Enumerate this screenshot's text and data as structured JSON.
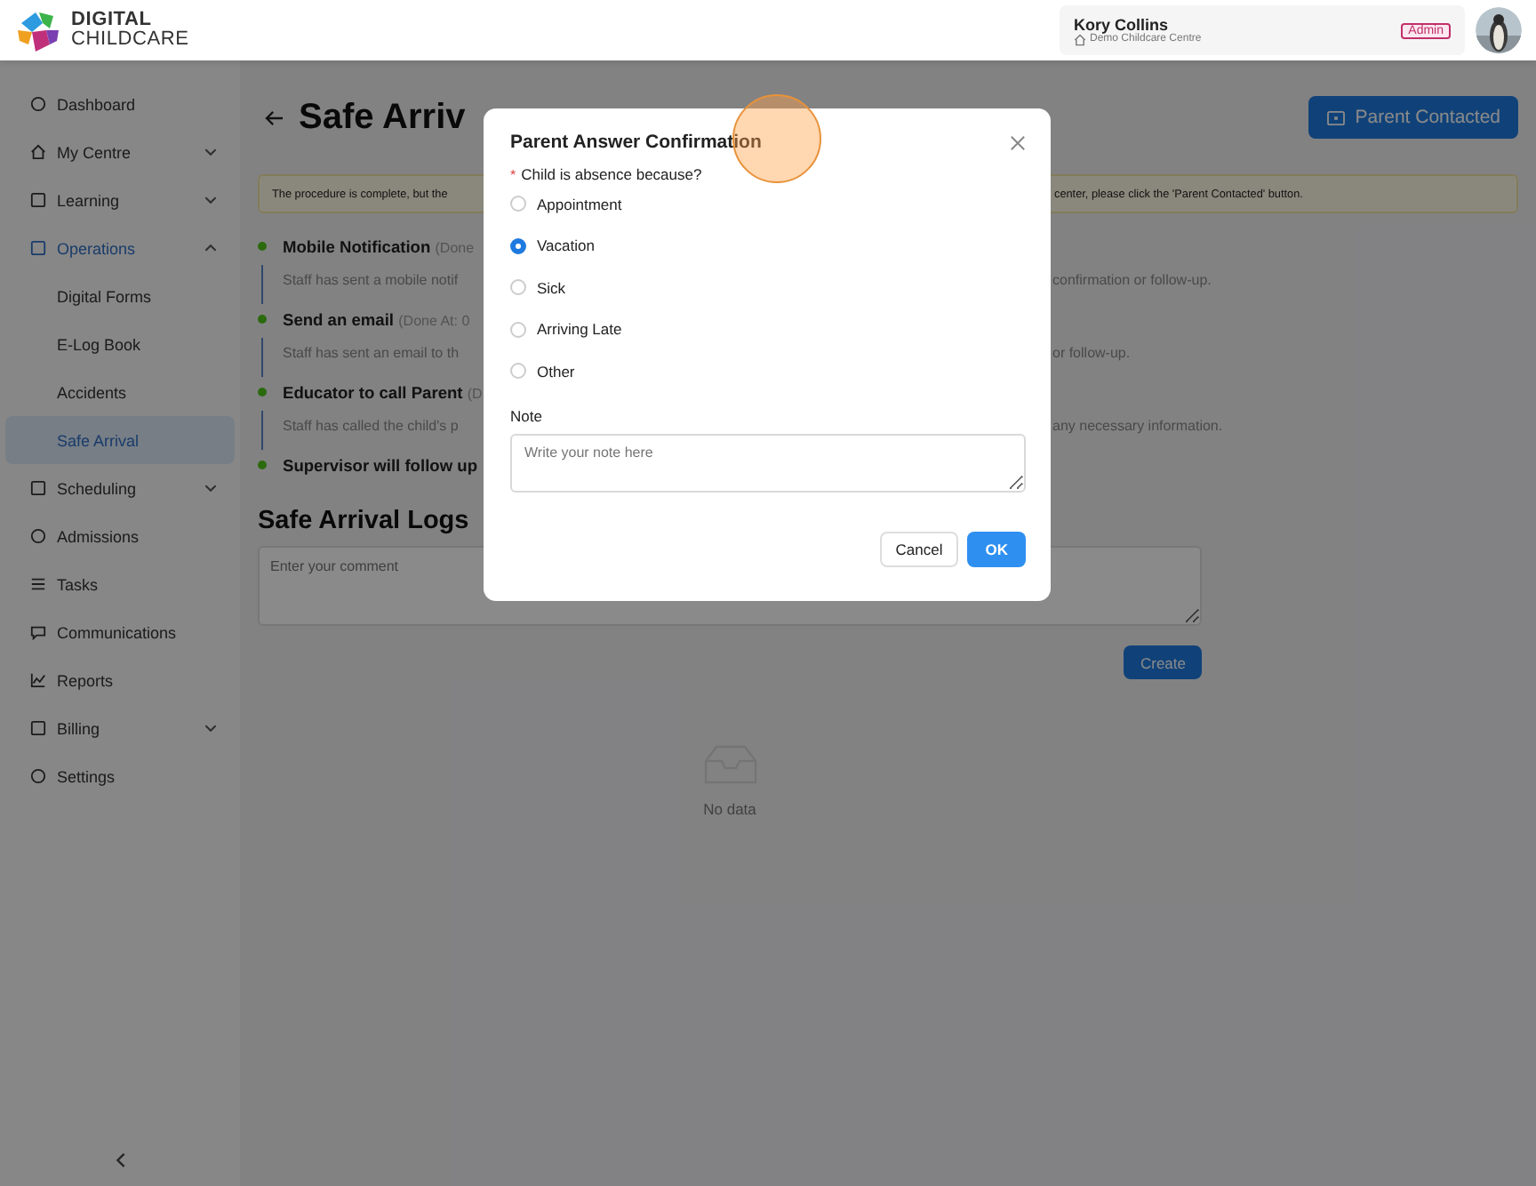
{
  "header": {
    "logo": [
      "DIGITAL",
      "CHILDCARE"
    ],
    "user": {
      "name": "Kory Collins",
      "centre": "Demo Childcare Centre",
      "role": "Admin"
    }
  },
  "sidebar": {
    "items": [
      {
        "label": "Dashboard",
        "selected": false
      },
      {
        "label": "My Centre",
        "selected": false,
        "expanded": false
      },
      {
        "label": "Learning",
        "selected": false,
        "expanded": false
      },
      {
        "label": "Operations",
        "selected": true,
        "expanded": true,
        "children": [
          {
            "label": "Digital Forms",
            "selected": false
          },
          {
            "label": "E-Log Book",
            "selected": false
          },
          {
            "label": "Accidents",
            "selected": false
          },
          {
            "label": "Safe Arrival",
            "selected": true
          }
        ]
      },
      {
        "label": "Scheduling",
        "selected": false,
        "expanded": false
      },
      {
        "label": "Admissions",
        "selected": false
      },
      {
        "label": "Tasks",
        "selected": false
      },
      {
        "label": "Communications",
        "selected": false
      },
      {
        "label": "Reports",
        "selected": false
      },
      {
        "label": "Billing",
        "selected": false,
        "expanded": false
      },
      {
        "label": "Settings",
        "selected": false
      }
    ]
  },
  "page": {
    "title": "Safe Arriv",
    "action": "Parent Contacted",
    "alert": {
      "left": "The procedure is complete, but the",
      "right": "center, please click the 'Parent Contacted' button."
    },
    "steps": [
      {
        "title": "Mobile Notification",
        "note": "(Done",
        "desc_left": "Staff has sent a mobile notif",
        "desc_right": "confirmation or follow-up."
      },
      {
        "title": "Send an email",
        "note": "(Done At: 0",
        "desc_left": "Staff has sent an email to th",
        "desc_right": "or follow-up."
      },
      {
        "title": "Educator to call Parent",
        "note": "(D",
        "desc_left": "Staff has called the child's p",
        "desc_right": "any necessary information."
      },
      {
        "title": "Supervisor will follow up"
      }
    ],
    "logs": {
      "title": "Safe Arrival Logs",
      "placeholder": "Enter your comment",
      "button": "Create",
      "empty": "No data"
    }
  },
  "dialog": {
    "title": "Parent Answer Confirmation",
    "required_mark": "*",
    "question": "Child is absence because?",
    "options": [
      {
        "label": "Appointment",
        "selected": false
      },
      {
        "label": "Vacation",
        "selected": true
      },
      {
        "label": "Sick",
        "selected": false
      },
      {
        "label": "Arriving Late",
        "selected": false
      },
      {
        "label": "Other",
        "selected": false
      }
    ],
    "note_label": "Note",
    "note_placeholder": "Write your note here",
    "buttons": [
      "Cancel",
      "OK"
    ]
  }
}
